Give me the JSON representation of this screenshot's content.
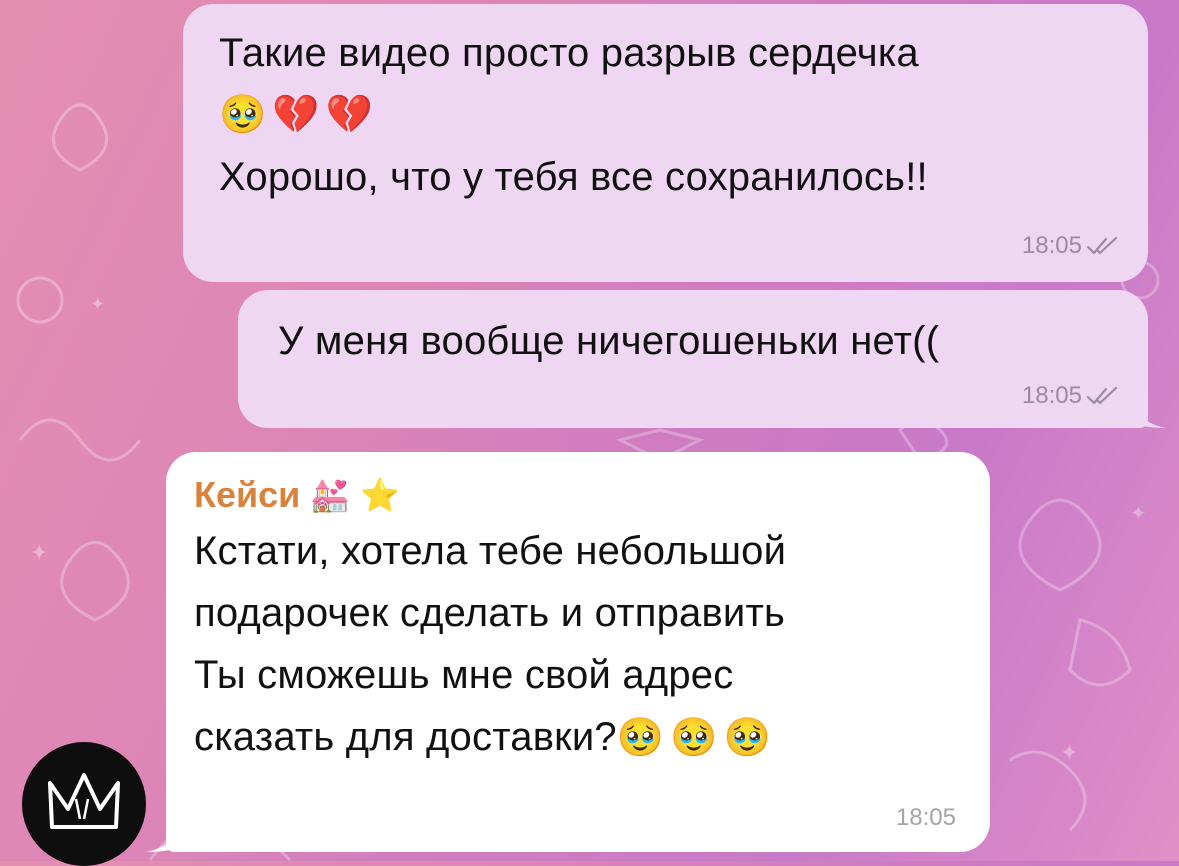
{
  "messages": [
    {
      "direction": "outgoing",
      "lines": [
        "Такие видео просто разрыв сердечка",
        "Хорошо, что у тебя все сохранилось!!"
      ],
      "emoji_line": [
        "🥹",
        "💔",
        "💔"
      ],
      "time": "18:05",
      "status_icon": "double-check-icon"
    },
    {
      "direction": "outgoing",
      "lines": [
        "У меня вообще ничегошеньки нет(("
      ],
      "time": "18:05",
      "status_icon": "double-check-icon"
    },
    {
      "direction": "incoming",
      "sender": "Кейси",
      "sender_emoji": [
        "💒",
        "⭐"
      ],
      "lines": [
        "Кстати, хотела тебе небольшой",
        "подарочек сделать и отправить",
        "Ты сможешь мне свой адрес",
        "сказать для доставки?"
      ],
      "trailing_emoji": [
        "🥹",
        "🥹",
        "🥹"
      ],
      "time": "18:05"
    }
  ],
  "avatar": {
    "icon": "crown-logo-icon"
  },
  "colors": {
    "outgoing_bubble": "#efd6f3",
    "incoming_bubble": "#ffffff",
    "sender_name": "#d9823c",
    "wallpaper_start": "#e58fb0",
    "wallpaper_end": "#c87ac9"
  }
}
